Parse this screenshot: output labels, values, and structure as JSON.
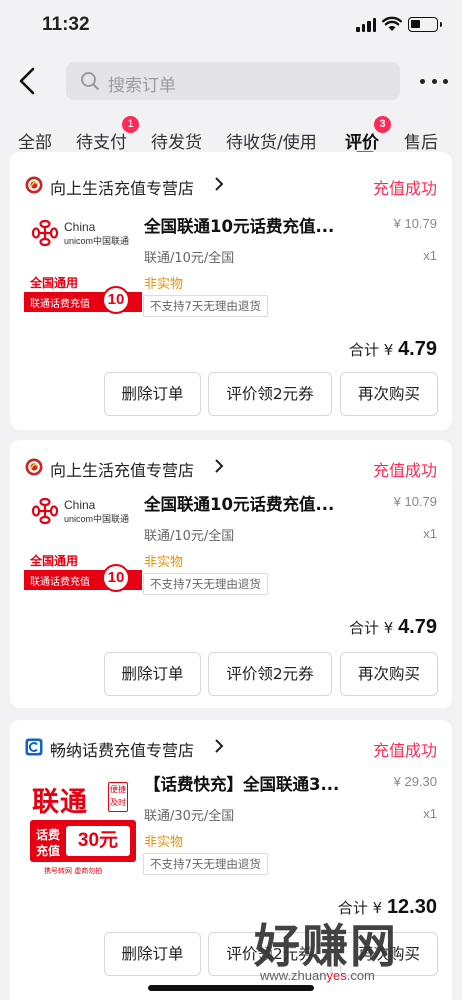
{
  "status_bar": {
    "time": "11:32"
  },
  "search": {
    "placeholder": "搜索订单"
  },
  "tabs": [
    {
      "label": "全部",
      "badge": ""
    },
    {
      "label": "待支付",
      "badge": "1"
    },
    {
      "label": "待发货",
      "badge": ""
    },
    {
      "label": "待收货/使用",
      "badge": ""
    },
    {
      "label": "评价",
      "badge": "3",
      "active": true
    },
    {
      "label": "售后",
      "badge": ""
    }
  ],
  "orders": [
    {
      "shop_name": "向上生活充值专营店",
      "status": "充值成功",
      "thumb": {
        "brand_en_1": "China",
        "brand_en_2": "unicom中国联通",
        "line1": "全国通用",
        "line2": "联通话费充值",
        "amount": "10"
      },
      "title": "全国联通10元话费充值...",
      "price": "¥ 10.79",
      "spec": "联通/10元/全国",
      "qty": "x1",
      "tag": "非实物",
      "note": "不支持7天无理由退货",
      "total_label": "合计 ¥ ",
      "total_value": "4.79",
      "buttons": [
        "删除订单",
        "评价领2元券",
        "再次购买"
      ]
    },
    {
      "shop_name": "向上生活充值专营店",
      "status": "充值成功",
      "thumb": {
        "brand_en_1": "China",
        "brand_en_2": "unicom中国联通",
        "line1": "全国通用",
        "line2": "联通话费充值",
        "amount": "10"
      },
      "title": "全国联通10元话费充值...",
      "price": "¥ 10.79",
      "spec": "联通/10元/全国",
      "qty": "x1",
      "tag": "非实物",
      "note": "不支持7天无理由退货",
      "total_label": "合计 ¥ ",
      "total_value": "4.79",
      "buttons": [
        "删除订单",
        "评价领2元券",
        "再次购买"
      ]
    },
    {
      "shop_name": "畅纳话费充值专营店",
      "status": "充值成功",
      "thumb": {
        "big": "联通",
        "side1": "便捷",
        "side2": "及时",
        "label1": "话费",
        "label2": "充值",
        "amount": "30元",
        "footer": "携号转网 虚商勿拍"
      },
      "title": "【话费快充】全国联通3...",
      "price": "¥ 29.30",
      "spec": "联通/30元/全国",
      "qty": "x1",
      "tag": "非实物",
      "note": "不支持7天无理由退货",
      "total_label": "合计 ¥ ",
      "total_value": "12.30",
      "buttons": [
        "删除订单",
        "评价领2元券",
        "再次购买"
      ]
    }
  ],
  "watermark": {
    "text_big": "好赚网",
    "url_pre": "www.zhuan",
    "url_mid": "yes",
    "url_post": ".com"
  },
  "colors": {
    "accent": "#ff2a55",
    "tag": "#e8920a",
    "unicom_red": "#e60012",
    "background": "#f2f2f4"
  }
}
